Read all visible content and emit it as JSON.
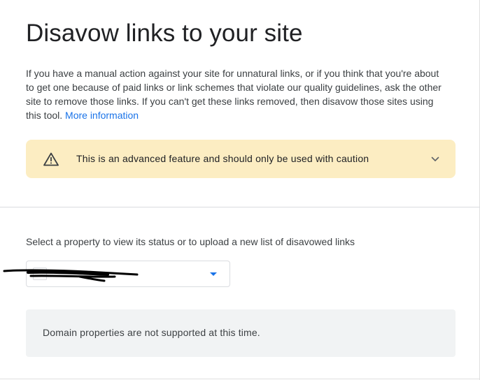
{
  "page": {
    "title": "Disavow links to your site",
    "intro_text": "If you have a manual action against your site for unnatural links, or if you think that you're about to get one because of paid links or link schemes that violate our quality guidelines, ask the other site to remove those links. If you can't get these links removed, then disavow those sites using this tool. ",
    "more_info_link": "More information"
  },
  "warning": {
    "text": "This is an advanced feature and should only be used with caution",
    "icon": "warning-triangle-icon",
    "chevron": "chevron-down-icon",
    "background_color": "#fcedc2"
  },
  "property_selector": {
    "label": "Select a property to view its status or to upload a new list of disavowed links",
    "selected_value": "",
    "dropdown_icon": "arrow-drop-down-icon",
    "accent_color": "#1a73e8"
  },
  "notice": {
    "text": "Domain properties are not supported at this time."
  }
}
